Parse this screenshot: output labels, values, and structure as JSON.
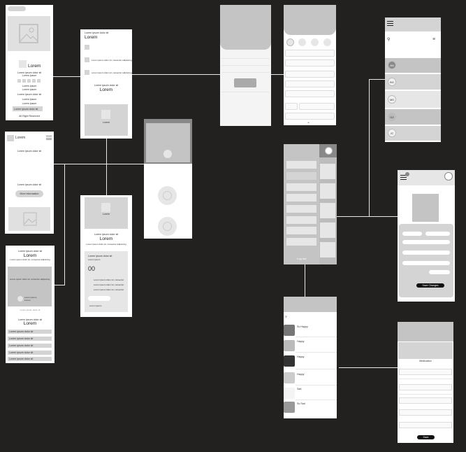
{
  "s1": {
    "title": "Lorem",
    "line1": "Lorem ipsum dolor sit",
    "line2": "Lorem ipsum",
    "l3": "Lorem ipsum",
    "l4": "Lorem ipsum",
    "line5": "Lorem ipsum dolor sit",
    "l6": "Lorem ipsum",
    "l7": "Lorem ipsum",
    "hl": "Lorem ipsum dolor sit",
    "footer": "All Right Reserved"
  },
  "s2": {
    "caption": "Lorem ipsum dolor sit",
    "title": "Lorem",
    "r1": "Lorem ipsum dolor sit, consectur adipiscing",
    "r2": "Lorem ipsum dolor sit, consectur adipiscing",
    "sub": "Lorem ipsum dolor sit",
    "title2": "Lorem",
    "imgcap": "Lorem"
  },
  "s3": {
    "logo": "Lorem",
    "line1": "Lorem ipsum dolor sit",
    "line2": "Lorem ipsum dolor sit",
    "btn": "More information"
  },
  "s4": {
    "cap": "Lorem ipsum dolor sit",
    "title": "Lorem",
    "sub": "Lorem ipsum dolor sit, consectur adipiscing",
    "imgtxt": "Lorem ipsum dolor sit, consectur adipiscing",
    "person1": "Lorem ipsum",
    "person2": "Lorem",
    "link": "Lorem ipsum dolor sit",
    "cap2": "Lorem ipsum dolor sit",
    "title2": "Lorem",
    "items": [
      "Lorem ipsum dolor sit",
      "Lorem ipsum dolor sit",
      "Lorem ipsum dolor sit",
      "Lorem ipsum dolor sit",
      "Lorem ipsum dolor sit"
    ]
  },
  "s5": {
    "imgcap": "Lorem",
    "cap": "Lorem ipsum dolor sit",
    "title": "Lorem",
    "sub": "Lorem ipsum dolor sit, consectur adipiscing",
    "card_title": "Lorem ipsum dolor sit",
    "card_sub": "Lorem ipsum",
    "number": "00",
    "list": [
      "Lorem ipsum dolor sit, consectur",
      "Lorem ipsum dolor sit, consectur",
      "Lorem ipsum dolor sit, consectur"
    ],
    "foot": "Lorem ipsum"
  },
  "s10": {
    "avatars": [
      "AN",
      "BG",
      "MD",
      "DZ",
      "JC"
    ]
  },
  "s11": {
    "button": "Save Changes"
  },
  "s12": {
    "logout": "Log out"
  },
  "s13": {
    "moods": [
      "So Happy",
      "Happy",
      "Happy",
      "Happy",
      "Sad",
      "So Sad"
    ]
  },
  "s14": {
    "label": "Medication",
    "button": "Save"
  }
}
